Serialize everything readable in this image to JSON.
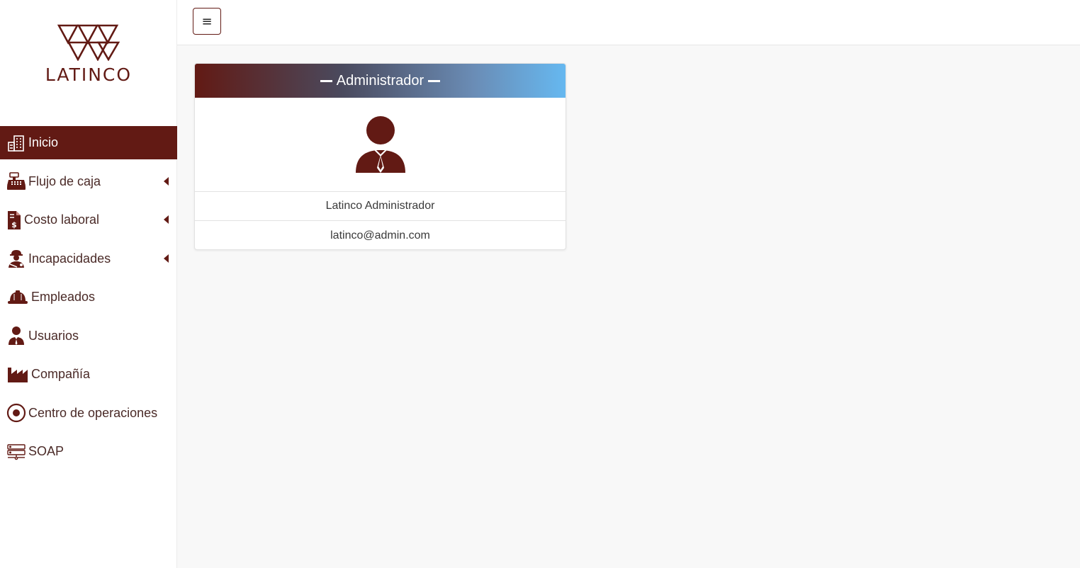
{
  "brand": {
    "name": "LATINCO",
    "color": "#621a14"
  },
  "topbar": {
    "menu_icon": "≡"
  },
  "sidebar": {
    "items": [
      {
        "label": "Inicio",
        "icon": "building-icon",
        "active": true,
        "expandable": false
      },
      {
        "label": "Flujo de caja",
        "icon": "cash-register-icon",
        "active": false,
        "expandable": true
      },
      {
        "label": "Costo laboral",
        "icon": "invoice-dollar-icon",
        "active": false,
        "expandable": true
      },
      {
        "label": "Incapacidades",
        "icon": "injured-worker-icon",
        "active": false,
        "expandable": true
      },
      {
        "label": "Empleados",
        "icon": "hard-hat-icon",
        "active": false,
        "expandable": false
      },
      {
        "label": "Usuarios",
        "icon": "user-tie-icon",
        "active": false,
        "expandable": false
      },
      {
        "label": "Compañía",
        "icon": "factory-icon",
        "active": false,
        "expandable": false
      },
      {
        "label": "Centro de operaciones",
        "icon": "dot-circle-icon",
        "active": false,
        "expandable": false
      },
      {
        "label": "SOAP",
        "icon": "network-icon",
        "active": false,
        "expandable": false
      }
    ]
  },
  "profile_card": {
    "title": "Administrador",
    "avatar_icon": "user-tie-icon",
    "name": "Latinco Administrador",
    "email": "latinco@admin.com"
  }
}
